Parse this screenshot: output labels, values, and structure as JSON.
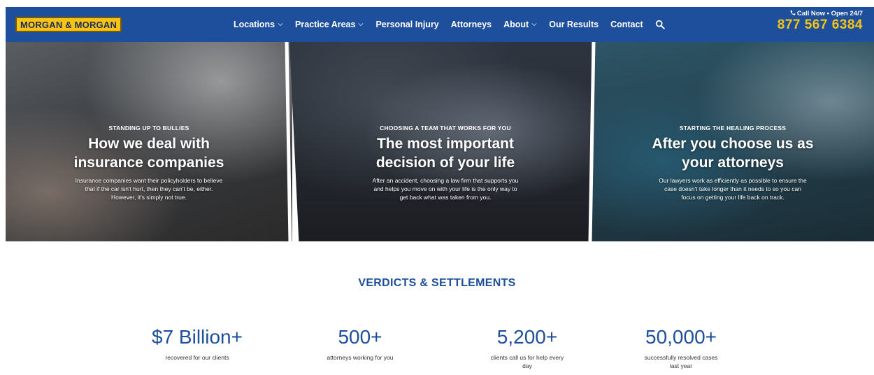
{
  "header": {
    "logo_text": "MORGAN & MORGAN",
    "nav": [
      {
        "label": "Locations",
        "has_dropdown": true
      },
      {
        "label": "Practice Areas",
        "has_dropdown": true
      },
      {
        "label": "Personal Injury",
        "has_dropdown": false
      },
      {
        "label": "Attorneys",
        "has_dropdown": false
      },
      {
        "label": "About",
        "has_dropdown": true
      },
      {
        "label": "Our Results",
        "has_dropdown": false
      },
      {
        "label": "Contact",
        "has_dropdown": false
      }
    ],
    "call_now": "Call Now • Open 24/7",
    "phone": "877 567 6384",
    "colors": {
      "bar": "#1d4f9c",
      "accent": "#f6c416"
    }
  },
  "hero": [
    {
      "eyebrow": "STANDING UP TO BULLIES",
      "headline_line1": "How we deal with",
      "headline_line2": "insurance companies",
      "description": "Insurance companies want their policyholders to believe that if the car isn't hurt, then they can't be, either. However, it's simply not true."
    },
    {
      "eyebrow": "CHOOSING A TEAM THAT WORKS FOR YOU",
      "headline_line1": "The most important",
      "headline_line2": "decision of your life",
      "description": "After an accident, choosing a law firm that supports you and helps you move on with your life is the only way to get back what was taken from you."
    },
    {
      "eyebrow": "STARTING THE HEALING PROCESS",
      "headline_line1": "After you choose us as",
      "headline_line2": "your attorneys",
      "description": "Our lawyers work as efficiently as possible to ensure the case doesn't take longer than it needs to so you can focus on getting your life back on track."
    }
  ],
  "verdicts": {
    "title": "VERDICTS & SETTLEMENTS",
    "stats": [
      {
        "value": "$7 Billion+",
        "label": "recovered for our clients"
      },
      {
        "value": "500+",
        "label": "attorneys working for you"
      },
      {
        "value": "5,200+",
        "label": "clients call us for help every day"
      },
      {
        "value": "50,000+",
        "label": "successfully resolved cases last year"
      }
    ]
  }
}
